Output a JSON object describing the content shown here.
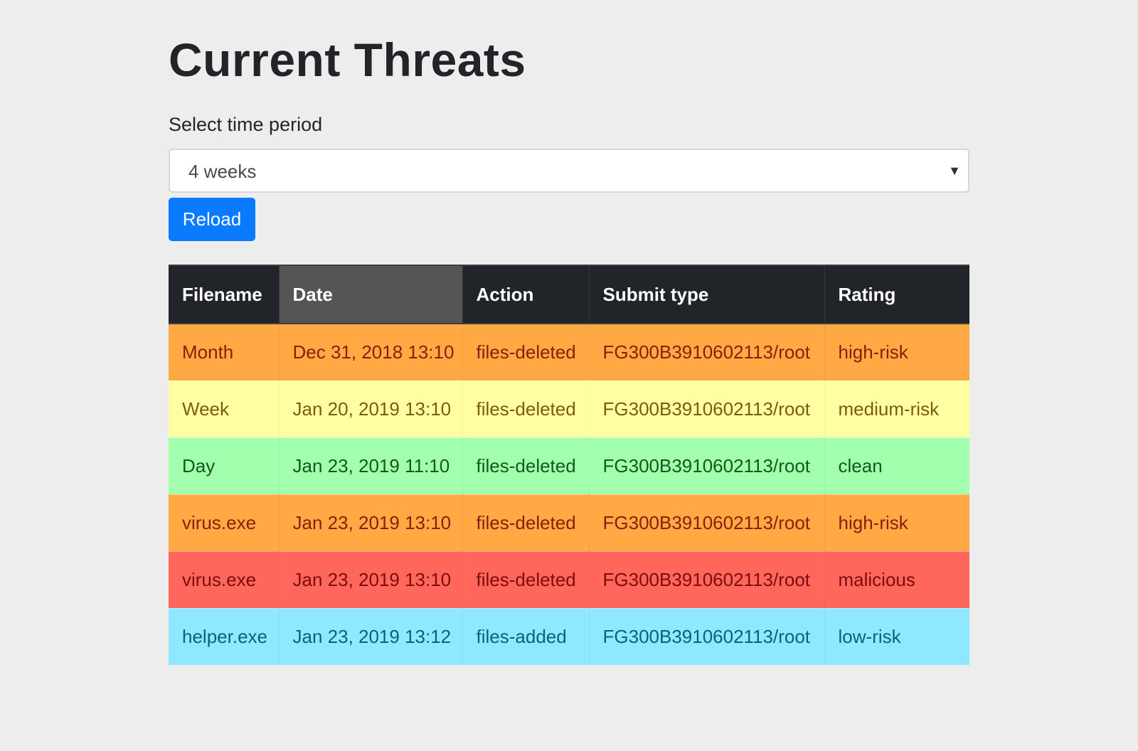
{
  "page": {
    "title": "Current Threats"
  },
  "filter": {
    "label": "Select time period",
    "selected": "4 weeks",
    "reload_label": "Reload"
  },
  "table": {
    "headers": [
      "Filename",
      "Date",
      "Action",
      "Submit type",
      "Rating"
    ],
    "sorted_column": "Date",
    "rows": [
      {
        "filename": "Month",
        "date": "Dec 31, 2018 13:10",
        "action": "files-deleted",
        "submit_type": "FG300B3910602113/root",
        "rating": "high-risk"
      },
      {
        "filename": "Week",
        "date": "Jan 20, 2019 13:10",
        "action": "files-deleted",
        "submit_type": "FG300B3910602113/root",
        "rating": "medium-risk"
      },
      {
        "filename": "Day",
        "date": "Jan 23, 2019 11:10",
        "action": "files-deleted",
        "submit_type": "FG300B3910602113/root",
        "rating": "clean"
      },
      {
        "filename": "virus.exe",
        "date": "Jan 23, 2019 13:10",
        "action": "files-deleted",
        "submit_type": "FG300B3910602113/root",
        "rating": "high-risk"
      },
      {
        "filename": "virus.exe",
        "date": "Jan 23, 2019 13:10",
        "action": "files-deleted",
        "submit_type": "FG300B3910602113/root",
        "rating": "malicious"
      },
      {
        "filename": "helper.exe",
        "date": "Jan 23, 2019 13:12",
        "action": "files-added",
        "submit_type": "FG300B3910602113/root",
        "rating": "low-risk"
      }
    ]
  },
  "colors": {
    "page_background": "#ededed",
    "header_background": "#212529",
    "sorted_header_background": "#555555",
    "button": "#0a7bff",
    "high-risk": "#ffa945",
    "medium-risk": "#ffffa2",
    "clean": "#a2ffae",
    "malicious": "#ff665c",
    "low-risk": "#8ee8ff"
  }
}
